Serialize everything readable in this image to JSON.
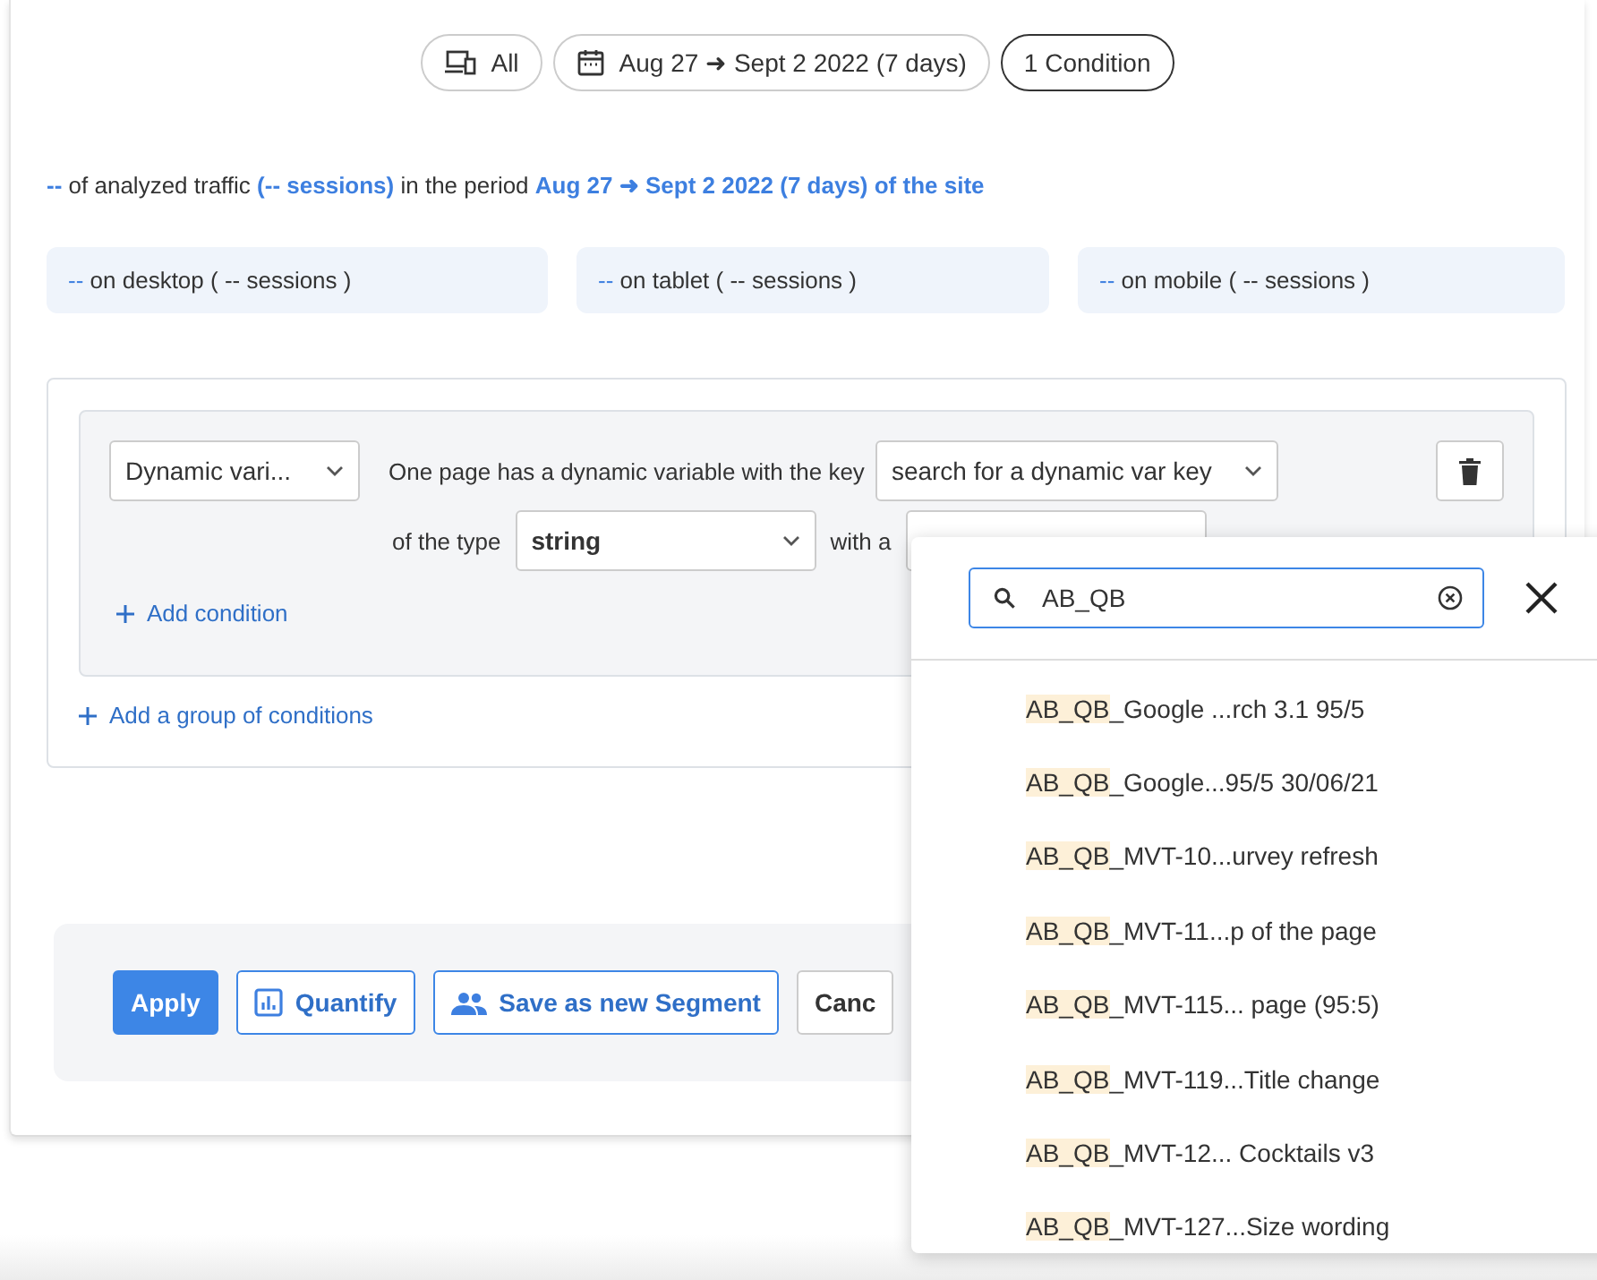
{
  "filters": [
    {
      "kind": "device",
      "label": "All",
      "selected": false
    },
    {
      "kind": "date",
      "label": "Aug 27 ➜ Sept 2 2022 (7 days)",
      "selected": false
    },
    {
      "kind": "conditions",
      "label": "1 Condition",
      "selected": true
    }
  ],
  "summary": [
    {
      "kind": "value",
      "text": "--"
    },
    {
      "kind": "plain",
      "text": " of analyzed traffic "
    },
    {
      "kind": "value",
      "text": "(-- sessions)"
    },
    {
      "kind": "plain",
      "text": " in the period "
    },
    {
      "kind": "value",
      "text": "Aug 27 ➜ Sept 2 2022 (7 days) of the site"
    }
  ],
  "devices": [
    {
      "value": "--",
      "label": "on desktop ( -- sessions )"
    },
    {
      "value": "--",
      "label": "on tablet ( -- sessions )"
    },
    {
      "value": "--",
      "label": "on mobile ( -- sessions )"
    }
  ],
  "condition": {
    "type_select": "Dynamic vari...",
    "key_text": "One page has a dynamic variable with the key",
    "key_select": "search for a dynamic var key",
    "type_text": "of the type",
    "value_type": "string",
    "with_text": "with a",
    "add_condition": "Add condition"
  },
  "add_group": "Add a group of conditions",
  "actions": [
    {
      "kind": "primary",
      "label": "Apply"
    },
    {
      "kind": "quantify",
      "label": "Quantify"
    },
    {
      "kind": "segment",
      "label": "Save as new Segment"
    },
    {
      "kind": "plain",
      "label": "Canc"
    }
  ],
  "search_popup": {
    "query": "AB_QB",
    "results": [
      {
        "match": "AB_QB",
        "rest": "_Google ...rch 3.1 95/5"
      },
      {
        "match": "AB_QB",
        "rest": "_Google...95/5 30/06/21"
      },
      {
        "match": "AB_QB",
        "rest": "_MVT-10...urvey refresh"
      },
      {
        "match": "AB_QB",
        "rest": "_MVT-11...p of the page"
      },
      {
        "match": "AB_QB",
        "rest": "_MVT-115... page (95:5)"
      },
      {
        "match": "AB_QB",
        "rest": "_MVT-119...Title change"
      },
      {
        "match": "AB_QB",
        "rest": "_MVT-12... Cocktails v3"
      },
      {
        "match": "AB_QB",
        "rest": "_MVT-127...Size wording"
      }
    ]
  }
}
